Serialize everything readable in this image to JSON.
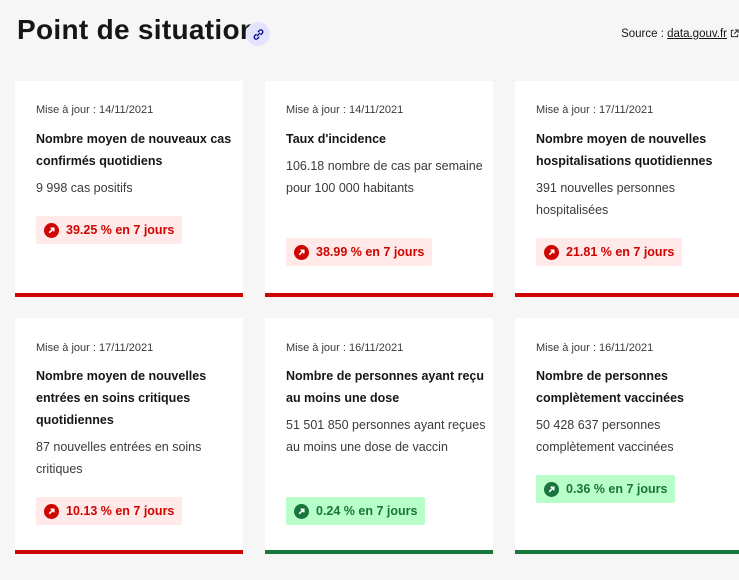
{
  "header": {
    "title": "Point de situation",
    "source_label": "Source : ",
    "source_link": "data.gouv.fr"
  },
  "colors": {
    "up": "#ce0500",
    "down": "#18753c",
    "link_bg": "#e3e3fd"
  },
  "cards": [
    {
      "date": "Mise à jour : 14/11/2021",
      "title": "Nombre moyen de nouveaux cas confirmés quotidiens",
      "value": "9 998 cas positifs",
      "trend": "39.25 % en 7 jours",
      "direction": "up"
    },
    {
      "date": "Mise à jour : 14/11/2021",
      "title": "Taux d'incidence",
      "value": "106.18 nombre de cas par semaine pour 100 000 habitants",
      "trend": "38.99 % en 7 jours",
      "direction": "up"
    },
    {
      "date": "Mise à jour : 17/11/2021",
      "title": "Nombre moyen de nouvelles hospitalisations quotidiennes",
      "value": "391 nouvelles personnes hospitalisées",
      "trend": "21.81 % en 7 jours",
      "direction": "up"
    },
    {
      "date": "Mise à jour : 17/11/2021",
      "title": "Nombre moyen de nouvelles entrées en soins critiques quotidiennes",
      "value": "87 nouvelles entrées en soins critiques",
      "trend": "10.13 % en 7 jours",
      "direction": "up"
    },
    {
      "date": "Mise à jour : 16/11/2021",
      "title": "Nombre de personnes ayant reçu au moins une dose",
      "value": "51 501 850 personnes ayant reçues au moins une dose de vaccin",
      "trend": "0.24 % en 7 jours",
      "direction": "down"
    },
    {
      "date": "Mise à jour : 16/11/2021",
      "title": "Nombre de personnes complètement vaccinées",
      "value": "50 428 637 personnes complètement vaccinées",
      "trend": "0.36 % en 7 jours",
      "direction": "down"
    }
  ]
}
